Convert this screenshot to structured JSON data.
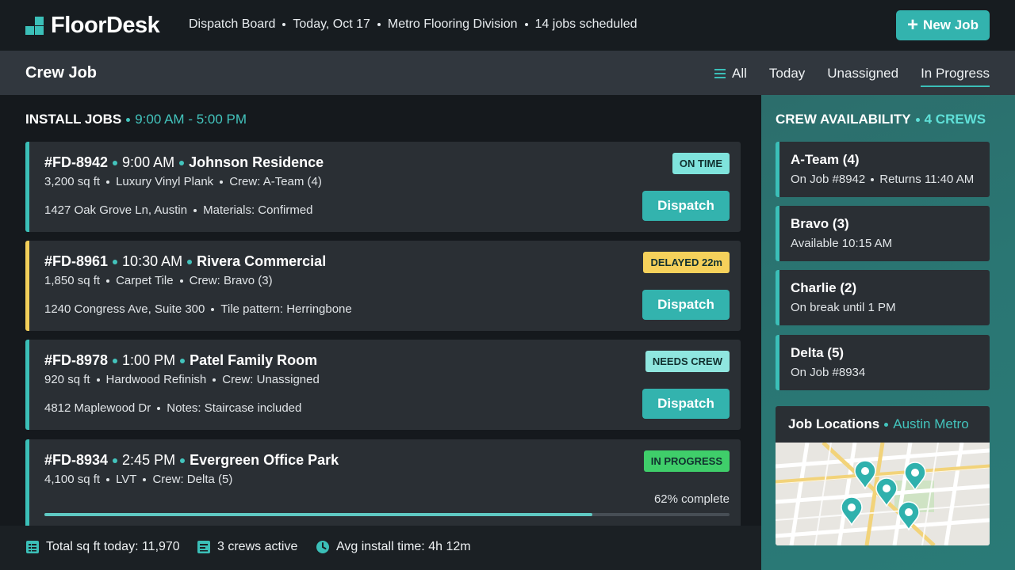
{
  "app": {
    "name": "FloorDesk",
    "meta": [
      "Dispatch Board",
      "Today, Oct 17",
      "Metro Flooring Division",
      "14 jobs scheduled"
    ],
    "new_job_label": "New Job"
  },
  "subheader": {
    "title": "Crew Job",
    "filters": [
      {
        "label": "All",
        "active": false
      },
      {
        "label": "Today",
        "active": false
      },
      {
        "label": "Unassigned",
        "active": false
      },
      {
        "label": "In Progress",
        "active": true
      }
    ]
  },
  "jobs_section": {
    "title": "INSTALL JOBS",
    "hours": "9:00 AM - 5:00 PM"
  },
  "jobs": [
    {
      "id": "#FD-8942",
      "time": "9:00 AM",
      "client": "Johnson Residence",
      "line1": [
        "3,200 sq ft",
        "Luxury Vinyl Plank",
        "Crew: A-Team (4)"
      ],
      "line2": [
        "1427 Oak Grove Ln, Austin",
        "Materials: Confirmed"
      ],
      "status": "ON TIME",
      "status_color": "#7fe3dc",
      "accent": "#3bbfb8",
      "action": "Dispatch"
    },
    {
      "id": "#FD-8961",
      "time": "10:30 AM",
      "client": "Rivera Commercial",
      "line1": [
        "1,850 sq ft",
        "Carpet Tile",
        "Crew: Bravo (3)"
      ],
      "line2": [
        "1240 Congress Ave, Suite 300",
        "Tile pattern: Herringbone"
      ],
      "status": "DELAYED 22m",
      "status_color": "#f5d15b",
      "accent": "#f2cf5a",
      "action": "Dispatch"
    },
    {
      "id": "#FD-8978",
      "time": "1:00 PM",
      "client": "Patel Family Room",
      "line1": [
        "920 sq ft",
        "Hardwood Refinish",
        "Crew: Unassigned"
      ],
      "line2": [
        "4812 Maplewood Dr",
        "Notes: Staircase included"
      ],
      "status": "NEEDS CREW",
      "status_color": "#8fe6df",
      "accent": "#3bbfb8",
      "action": "Dispatch"
    },
    {
      "id": "#FD-8934",
      "time": "2:45 PM",
      "client": "Evergreen Office Park",
      "line1": [
        "4,100 sq ft",
        "LVT",
        "Crew: Delta (5)"
      ],
      "progress_label": "62% complete",
      "progress": 0.8,
      "status": "IN PROGRESS",
      "status_color": "#3fce6a",
      "accent": "#3bbfb8"
    }
  ],
  "footer": {
    "total_sqft": "Total sq ft today: 11,970",
    "crews_active": "3 crews active",
    "avg_install": "Avg install time: 4h 12m"
  },
  "crew_panel": {
    "title": "CREW AVAILABILITY",
    "count": "4 crews",
    "crews": [
      {
        "name": "A-Team (4)",
        "status": [
          "On Job #8942",
          "Returns 11:40 AM"
        ]
      },
      {
        "name": "Bravo (3)",
        "status": [
          "Available 10:15 AM"
        ]
      },
      {
        "name": "Charlie (2)",
        "status": [
          "On break until 1 PM"
        ]
      },
      {
        "name": "Delta (5)",
        "status": [
          "On Job #8934"
        ]
      }
    ]
  },
  "map": {
    "title": "Job Locations",
    "region": "Austin Metro",
    "pin_color": "#2fb1ad"
  }
}
